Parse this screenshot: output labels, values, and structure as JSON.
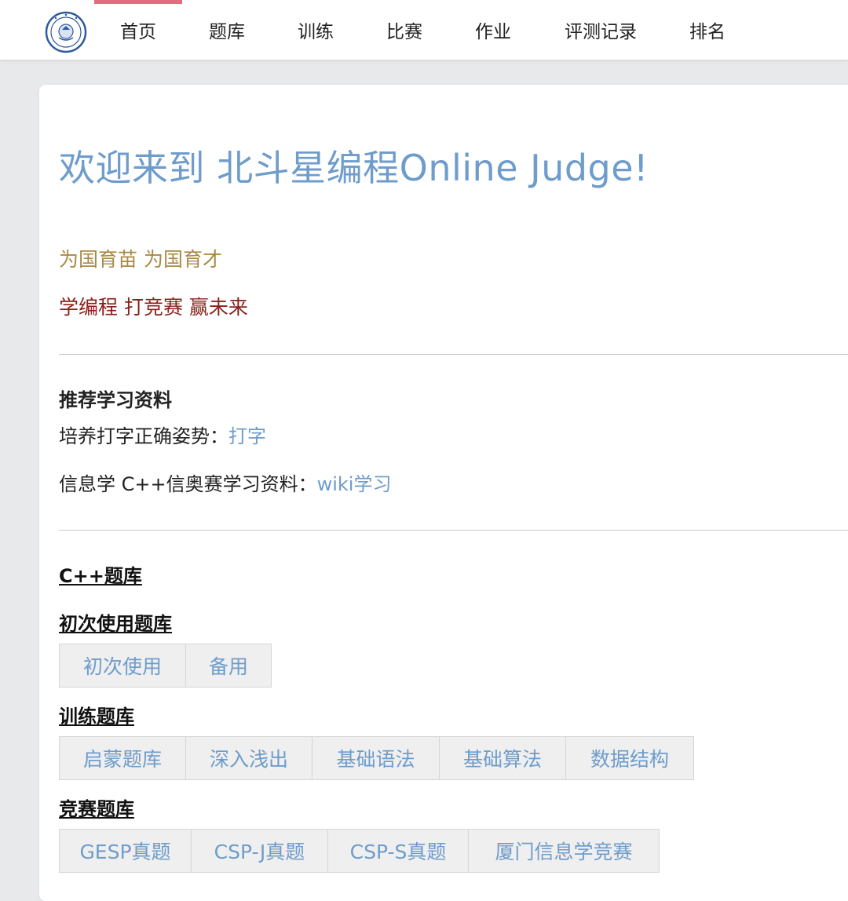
{
  "nav": {
    "items": [
      {
        "label": "首页",
        "active": true
      },
      {
        "label": "题库",
        "active": false
      },
      {
        "label": "训练",
        "active": false
      },
      {
        "label": "比赛",
        "active": false
      },
      {
        "label": "作业",
        "active": false
      },
      {
        "label": "评测记录",
        "active": false
      },
      {
        "label": "排名",
        "active": false
      }
    ],
    "logo_icon": "school-emblem-icon",
    "active_color": "#e26d80"
  },
  "main": {
    "welcome": "欢迎来到 北斗星编程Online Judge!",
    "motto1": "为国育苗 为国育才",
    "motto2": "学编程 打竞赛 赢未来",
    "resources": {
      "title": "推荐学习资料",
      "typing_prefix": "培养打字正确姿势：",
      "typing_link": "打字",
      "wiki_prefix": "信息学 C++信奥赛学习资料：",
      "wiki_link": "wiki学习"
    },
    "cpp_bank_title": "C++题库",
    "banks": [
      {
        "title": "初次使用题库",
        "buttons": [
          "初次使用",
          "备用"
        ]
      },
      {
        "title": "训练题库",
        "buttons": [
          "启蒙题库",
          "深入浅出",
          "基础语法",
          "基础算法",
          "数据结构"
        ]
      },
      {
        "title": "竞赛题库",
        "buttons": [
          "GESP真题",
          "CSP-J真题",
          "CSP-S真题",
          "厦门信息学竞赛"
        ]
      }
    ]
  },
  "colors": {
    "link": "#6e9ccb",
    "motto1": "#a98a45",
    "motto2": "#8b1f1a"
  }
}
